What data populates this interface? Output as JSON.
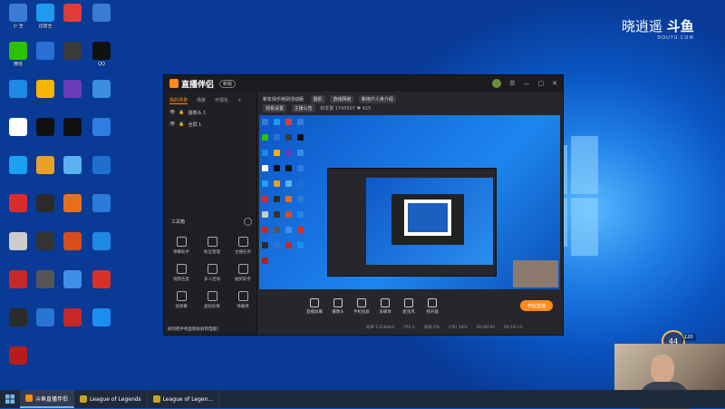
{
  "brand": {
    "name": "晓逍遥",
    "logo": "斗鱼",
    "domain": "DOUYU.COM"
  },
  "colors": {
    "accent": "#ff8c1a",
    "desktop": "#0b55c2",
    "taskbar": "#1f2a3a"
  },
  "desktop_icons": [
    {
      "label": "小 全",
      "icon": "bird-icon",
      "color": "#3a7bd5"
    },
    {
      "label": "迅雷全",
      "icon": "lightning-icon",
      "color": "#1e9bf0"
    },
    {
      "label": "",
      "icon": "app-icon",
      "color": "#e03c3c"
    },
    {
      "label": "",
      "icon": "bird-icon",
      "color": "#3a7bd5"
    },
    {
      "label": "微信",
      "icon": "wechat-icon",
      "color": "#2dc100"
    },
    {
      "label": "",
      "icon": "app-icon",
      "color": "#2a6fd6"
    },
    {
      "label": "",
      "icon": "app-icon",
      "color": "#3b3b3b"
    },
    {
      "label": "QQ",
      "icon": "qq-icon",
      "color": "#111111"
    },
    {
      "label": "",
      "icon": "browser-icon",
      "color": "#1e88e5"
    },
    {
      "label": "",
      "icon": "app-icon",
      "color": "#f5b400"
    },
    {
      "label": "",
      "icon": "app-icon",
      "color": "#6a3db8"
    },
    {
      "label": "",
      "icon": "app-icon",
      "color": "#3b8ddf"
    },
    {
      "label": "",
      "icon": "app-icon",
      "color": "#ffffff"
    },
    {
      "label": "",
      "icon": "capcut-icon",
      "color": "#111111"
    },
    {
      "label": "",
      "icon": "tiktok-icon",
      "color": "#111111"
    },
    {
      "label": "",
      "icon": "app-icon",
      "color": "#2f7de1"
    },
    {
      "label": "",
      "icon": "app-icon",
      "color": "#1ca0f2"
    },
    {
      "label": "",
      "icon": "app-icon",
      "color": "#e8a02a"
    },
    {
      "label": "",
      "icon": "app-icon",
      "color": "#5bb0f0"
    },
    {
      "label": "",
      "icon": "app-icon",
      "color": "#1f6fd1"
    },
    {
      "label": "",
      "icon": "app-icon",
      "color": "#d92c2c"
    },
    {
      "label": "",
      "icon": "app-icon",
      "color": "#2b2b2b"
    },
    {
      "label": "",
      "icon": "app-icon",
      "color": "#e96f1c"
    },
    {
      "label": "",
      "icon": "app-icon",
      "color": "#2b7bd9"
    },
    {
      "label": "",
      "icon": "app-icon",
      "color": "#cccccc"
    },
    {
      "label": "",
      "icon": "app-icon",
      "color": "#333333"
    },
    {
      "label": "",
      "icon": "app-icon",
      "color": "#d94c1c"
    },
    {
      "label": "",
      "icon": "ie-icon",
      "color": "#1e88e5"
    },
    {
      "label": "",
      "icon": "app-icon",
      "color": "#c62828"
    },
    {
      "label": "",
      "icon": "app-icon",
      "color": "#555555"
    },
    {
      "label": "",
      "icon": "app-icon",
      "color": "#3f8fe8"
    },
    {
      "label": "",
      "icon": "wps-icon",
      "color": "#d93025"
    },
    {
      "label": "",
      "icon": "app-icon",
      "color": "#2b2b2b"
    },
    {
      "label": "",
      "icon": "app-icon",
      "color": "#2a74d4"
    },
    {
      "label": "",
      "icon": "app-icon",
      "color": "#c62828"
    },
    {
      "label": "",
      "icon": "app-icon",
      "color": "#1b8ef2"
    },
    {
      "label": "",
      "icon": "app-icon",
      "color": "#b71c1c"
    }
  ],
  "app": {
    "title": "直播伴侣",
    "version": "新版",
    "tabs": [
      "我的场景",
      "场景",
      "可视化"
    ],
    "scenes": [
      "摄像头 1",
      "全屏 1"
    ],
    "info": {
      "title": "新年快乐特别活动版",
      "chip1": "摄影",
      "chip2": "游戏网络",
      "chip3": "新用户人身介绍",
      "chip4": "观看设置",
      "chip5": "主播公告",
      "stats": "转发量 1745697  ♥ 425"
    },
    "toolbox_title": "工具箱",
    "tools": [
      "弹幕助手",
      "粉丝管理",
      "主播任务",
      "视频连麦",
      "多人连线",
      "抽奖助手",
      "滚弹幕",
      "虚拟形象",
      "弹幕库"
    ],
    "bottom_msg": "如何把手机直接投屏到电脑?",
    "controls": [
      "直播屏幕",
      "摄像头",
      "手机投屏",
      "多媒体",
      "麦克风",
      "扬声器"
    ],
    "start_label": "开始直播",
    "status": [
      "码率 1314kb/s",
      "FPS 0",
      "丢帧 0%",
      "CPU 16%",
      "00:00:00",
      "00:18:13"
    ]
  },
  "overlay": {
    "level": "44",
    "level_info": "120"
  },
  "taskbar": {
    "items": [
      {
        "label": "斗鱼直播伴侣",
        "active": true
      },
      {
        "label": "League of Legends",
        "active": false
      },
      {
        "label": "League of Legen...",
        "active": false
      }
    ]
  }
}
